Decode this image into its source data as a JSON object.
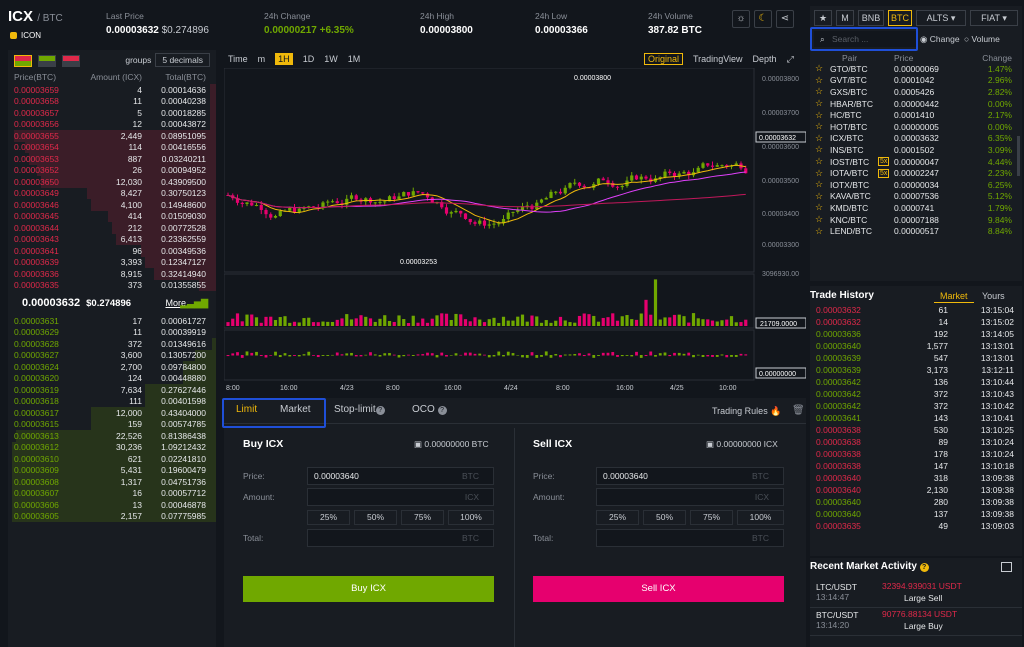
{
  "header": {
    "pair": "ICX",
    "quote": "/ BTC",
    "coin": "ICON",
    "last_price_label": "Last Price",
    "last_price": "0.00003632",
    "last_price_usd": "$0.274896",
    "change_label": "24h Change",
    "change_value": "0.00000217 +6.35%",
    "high_label": "24h High",
    "high_value": "0.00003800",
    "low_label": "24h Low",
    "low_value": "0.00003366",
    "volume_label": "24h Volume",
    "volume_value": "387.82 BTC"
  },
  "orderbook": {
    "groups_label": "groups",
    "groups_value": "5 decimals",
    "col_price": "Price(BTC)",
    "col_amount": "Amount (ICX)",
    "col_total": "Total(BTC)",
    "asks": [
      {
        "price": "0.00003659",
        "amount": "4",
        "total": "0.00014636",
        "depth": 0.03
      },
      {
        "price": "0.00003658",
        "amount": "11",
        "total": "0.00040238",
        "depth": 0.03
      },
      {
        "price": "0.00003657",
        "amount": "5",
        "total": "0.00018285",
        "depth": 0.03
      },
      {
        "price": "0.00003656",
        "amount": "12",
        "total": "0.00043872",
        "depth": 0.03
      },
      {
        "price": "0.00003655",
        "amount": "2,449",
        "total": "0.08951095",
        "depth": 0.97
      },
      {
        "price": "0.00003654",
        "amount": "114",
        "total": "0.00416556",
        "depth": 0.92
      },
      {
        "price": "0.00003653",
        "amount": "887",
        "total": "0.03240211",
        "depth": 0.9
      },
      {
        "price": "0.00003652",
        "amount": "26",
        "total": "0.00094952",
        "depth": 0.86
      },
      {
        "price": "0.00003650",
        "amount": "12,030",
        "total": "0.43909500",
        "depth": 0.84
      },
      {
        "price": "0.00003649",
        "amount": "8,427",
        "total": "0.30750123",
        "depth": 0.62
      },
      {
        "price": "0.00003646",
        "amount": "4,100",
        "total": "0.14948600",
        "depth": 0.6
      },
      {
        "price": "0.00003645",
        "amount": "414",
        "total": "0.01509030",
        "depth": 0.52
      },
      {
        "price": "0.00003644",
        "amount": "212",
        "total": "0.00772528",
        "depth": 0.5
      },
      {
        "price": "0.00003643",
        "amount": "6,413",
        "total": "0.23362559",
        "depth": 0.48
      },
      {
        "price": "0.00003641",
        "amount": "96",
        "total": "0.00349536",
        "depth": 0.36
      },
      {
        "price": "0.00003639",
        "amount": "3,393",
        "total": "0.12347127",
        "depth": 0.34
      },
      {
        "price": "0.00003636",
        "amount": "8,915",
        "total": "0.32414940",
        "depth": 0.3
      },
      {
        "price": "0.00003635",
        "amount": "373",
        "total": "0.01355855",
        "depth": 0.08
      }
    ],
    "mid_price": "0.00003632",
    "mid_usd": "$0.274896",
    "more": "More",
    "bids": [
      {
        "price": "0.00003631",
        "amount": "17",
        "total": "0.00061727",
        "depth": 0.0
      },
      {
        "price": "0.00003629",
        "amount": "11",
        "total": "0.00039919",
        "depth": 0.0
      },
      {
        "price": "0.00003628",
        "amount": "372",
        "total": "0.01349616",
        "depth": 0.02
      },
      {
        "price": "0.00003627",
        "amount": "3,600",
        "total": "0.13057200",
        "depth": 0.1
      },
      {
        "price": "0.00003624",
        "amount": "2,700",
        "total": "0.09784800",
        "depth": 0.16
      },
      {
        "price": "0.00003620",
        "amount": "124",
        "total": "0.00448880",
        "depth": 0.16
      },
      {
        "price": "0.00003619",
        "amount": "7,634",
        "total": "0.27627446",
        "depth": 0.34
      },
      {
        "price": "0.00003618",
        "amount": "111",
        "total": "0.00401598",
        "depth": 0.34
      },
      {
        "price": "0.00003617",
        "amount": "12,000",
        "total": "0.43404000",
        "depth": 0.6
      },
      {
        "price": "0.00003615",
        "amount": "159",
        "total": "0.00574785",
        "depth": 0.6
      },
      {
        "price": "0.00003613",
        "amount": "22,526",
        "total": "0.81386438",
        "depth": 0.96
      },
      {
        "price": "0.00003612",
        "amount": "30,236",
        "total": "1.09212432",
        "depth": 0.98
      },
      {
        "price": "0.00003610",
        "amount": "621",
        "total": "0.02241810",
        "depth": 0.98
      },
      {
        "price": "0.00003609",
        "amount": "5,431",
        "total": "0.19600479",
        "depth": 0.98
      },
      {
        "price": "0.00003608",
        "amount": "1,317",
        "total": "0.04751736",
        "depth": 0.98
      },
      {
        "price": "0.00003607",
        "amount": "16",
        "total": "0.00057712",
        "depth": 0.98
      },
      {
        "price": "0.00003606",
        "amount": "13",
        "total": "0.00046878",
        "depth": 0.98
      },
      {
        "price": "0.00003605",
        "amount": "2,157",
        "total": "0.07775985",
        "depth": 0.98
      }
    ]
  },
  "chart": {
    "tools": [
      "Time",
      "m",
      "1H",
      "1D",
      "1W",
      "1M"
    ],
    "active_tool": "1H",
    "original": "Original",
    "tradingview": "TradingView",
    "depth": "Depth",
    "y_ticks": [
      "0.00003800",
      "0.00003700",
      "0.00003600",
      "0.00003500",
      "0.00003400",
      "0.00003300",
      "3096930.00"
    ],
    "current_price": "0.00003632",
    "high_mark": "0.00003800",
    "low_mark": "0.00003253",
    "volume_mark": "21709.0000",
    "macd_mark": "0.00000000",
    "x_ticks": [
      "8:00",
      "16:00",
      "4/23",
      "8:00",
      "16:00",
      "4/24",
      "8:00",
      "16:00",
      "4/25",
      "10:00"
    ]
  },
  "form": {
    "tabs": [
      "Limit",
      "Market",
      "Stop-limit",
      "OCO"
    ],
    "trading_rules": "Trading Rules",
    "buy": {
      "title": "Buy ICX",
      "balance": "0.00000000 BTC",
      "price_label": "Price:",
      "price_value": "0.00003640",
      "price_unit": "BTC",
      "amount_label": "Amount:",
      "amount_unit": "ICX",
      "total_label": "Total:",
      "total_unit": "BTC",
      "pcts": [
        "25%",
        "50%",
        "75%",
        "100%"
      ],
      "button": "Buy ICX"
    },
    "sell": {
      "title": "Sell ICX",
      "balance": "0.00000000 ICX",
      "price_label": "Price:",
      "price_value": "0.00003640",
      "price_unit": "BTC",
      "amount_label": "Amount:",
      "amount_unit": "ICX",
      "total_label": "Total:",
      "total_unit": "BTC",
      "pcts": [
        "25%",
        "50%",
        "75%",
        "100%"
      ],
      "button": "Sell ICX"
    }
  },
  "markets": {
    "tabs": [
      "M",
      "BNB",
      "BTC",
      "ALTS",
      "FIAT"
    ],
    "active": "BTC",
    "search_placeholder": "Search ...",
    "radio_change": "Change",
    "radio_volume": "Volume",
    "col_pair": "Pair",
    "col_price": "Price",
    "col_change": "Change",
    "rows": [
      {
        "pair": "GTO/BTC",
        "price": "0.00000069",
        "change": "1.47%",
        "lev": ""
      },
      {
        "pair": "GVT/BTC",
        "price": "0.0001042",
        "change": "2.96%",
        "lev": ""
      },
      {
        "pair": "GXS/BTC",
        "price": "0.0005426",
        "change": "2.82%",
        "lev": ""
      },
      {
        "pair": "HBAR/BTC",
        "price": "0.00000442",
        "change": "0.00%",
        "lev": ""
      },
      {
        "pair": "HC/BTC",
        "price": "0.0001410",
        "change": "2.17%",
        "lev": ""
      },
      {
        "pair": "HOT/BTC",
        "price": "0.00000005",
        "change": "0.00%",
        "lev": ""
      },
      {
        "pair": "ICX/BTC",
        "price": "0.00003632",
        "change": "6.35%",
        "lev": ""
      },
      {
        "pair": "INS/BTC",
        "price": "0.0001502",
        "change": "3.09%",
        "lev": ""
      },
      {
        "pair": "IOST/BTC",
        "price": "0.00000047",
        "change": "4.44%",
        "lev": "5x"
      },
      {
        "pair": "IOTA/BTC",
        "price": "0.00002247",
        "change": "2.23%",
        "lev": "5x"
      },
      {
        "pair": "IOTX/BTC",
        "price": "0.00000034",
        "change": "6.25%",
        "lev": ""
      },
      {
        "pair": "KAVA/BTC",
        "price": "0.00007536",
        "change": "5.12%",
        "lev": ""
      },
      {
        "pair": "KMD/BTC",
        "price": "0.0000741",
        "change": "1.79%",
        "lev": ""
      },
      {
        "pair": "KNC/BTC",
        "price": "0.00007188",
        "change": "9.84%",
        "lev": ""
      },
      {
        "pair": "LEND/BTC",
        "price": "0.00000517",
        "change": "8.84%",
        "lev": ""
      }
    ]
  },
  "trade_history": {
    "title": "Trade History",
    "tab_market": "Market",
    "tab_yours": "Yours",
    "rows": [
      {
        "price": "0.00003632",
        "amount": "61",
        "time": "13:15:04",
        "side": "sell"
      },
      {
        "price": "0.00003632",
        "amount": "14",
        "time": "13:15:02",
        "side": "sell"
      },
      {
        "price": "0.00003636",
        "amount": "192",
        "time": "13:14:05",
        "side": "buy"
      },
      {
        "price": "0.00003640",
        "amount": "1,577",
        "time": "13:13:01",
        "side": "buy"
      },
      {
        "price": "0.00003639",
        "amount": "547",
        "time": "13:13:01",
        "side": "buy"
      },
      {
        "price": "0.00003639",
        "amount": "3,173",
        "time": "13:12:11",
        "side": "buy"
      },
      {
        "price": "0.00003642",
        "amount": "136",
        "time": "13:10:44",
        "side": "buy"
      },
      {
        "price": "0.00003642",
        "amount": "372",
        "time": "13:10:43",
        "side": "buy"
      },
      {
        "price": "0.00003642",
        "amount": "372",
        "time": "13:10:42",
        "side": "buy"
      },
      {
        "price": "0.00003641",
        "amount": "143",
        "time": "13:10:41",
        "side": "buy"
      },
      {
        "price": "0.00003638",
        "amount": "530",
        "time": "13:10:25",
        "side": "sell"
      },
      {
        "price": "0.00003638",
        "amount": "89",
        "time": "13:10:24",
        "side": "sell"
      },
      {
        "price": "0.00003638",
        "amount": "178",
        "time": "13:10:24",
        "side": "sell"
      },
      {
        "price": "0.00003638",
        "amount": "147",
        "time": "13:10:18",
        "side": "sell"
      },
      {
        "price": "0.00003640",
        "amount": "318",
        "time": "13:09:38",
        "side": "sell"
      },
      {
        "price": "0.00003640",
        "amount": "2,130",
        "time": "13:09:38",
        "side": "sell"
      },
      {
        "price": "0.00003640",
        "amount": "280",
        "time": "13:09:38",
        "side": "buy"
      },
      {
        "price": "0.00003640",
        "amount": "137",
        "time": "13:09:38",
        "side": "buy"
      },
      {
        "price": "0.00003635",
        "amount": "49",
        "time": "13:09:03",
        "side": "sell"
      }
    ]
  },
  "recent_activity": {
    "title": "Recent Market Activity",
    "rows": [
      {
        "pair": "LTC/USDT",
        "time": "13:14:47",
        "value": "32394.939031 USDT",
        "label": "Large Sell",
        "side": "sell"
      },
      {
        "pair": "BTC/USDT",
        "time": "13:14:20",
        "value": "90776.88134 USDT",
        "label": "Large Buy",
        "side": "buy"
      }
    ]
  },
  "colors": {
    "green": "#70a800",
    "red": "#e0294a",
    "yellow": "#f0b90b",
    "highlight": "#1f4fd8"
  }
}
